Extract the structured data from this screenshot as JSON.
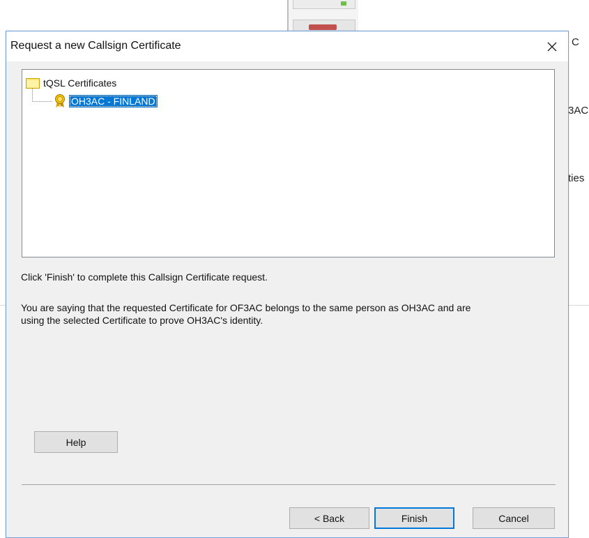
{
  "background": {
    "right_text_1": "C",
    "right_text_2": "3AC",
    "right_text_3": "ties"
  },
  "dialog": {
    "title": "Request a new Callsign Certificate",
    "close_icon": "close-icon",
    "tree": {
      "root_label": "tQSL Certificates",
      "root_icon": "folder-icon",
      "child_label": "OH3AC - FINLAND",
      "child_icon": "certificate-icon",
      "child_selected": true
    },
    "message_1": "Click 'Finish' to complete this Callsign Certificate request.",
    "message_2": "You are saying that the requested Certificate for OF3AC belongs to the same person as OH3AC and are using the selected Certificate to prove OH3AC's identity.",
    "buttons": {
      "help": "Help",
      "back": "< Back",
      "finish": "Finish",
      "cancel": "Cancel"
    },
    "colors": {
      "selection": "#0078d7",
      "border": "#6f9fd8",
      "dialog_bg": "#f0f0f0"
    }
  }
}
